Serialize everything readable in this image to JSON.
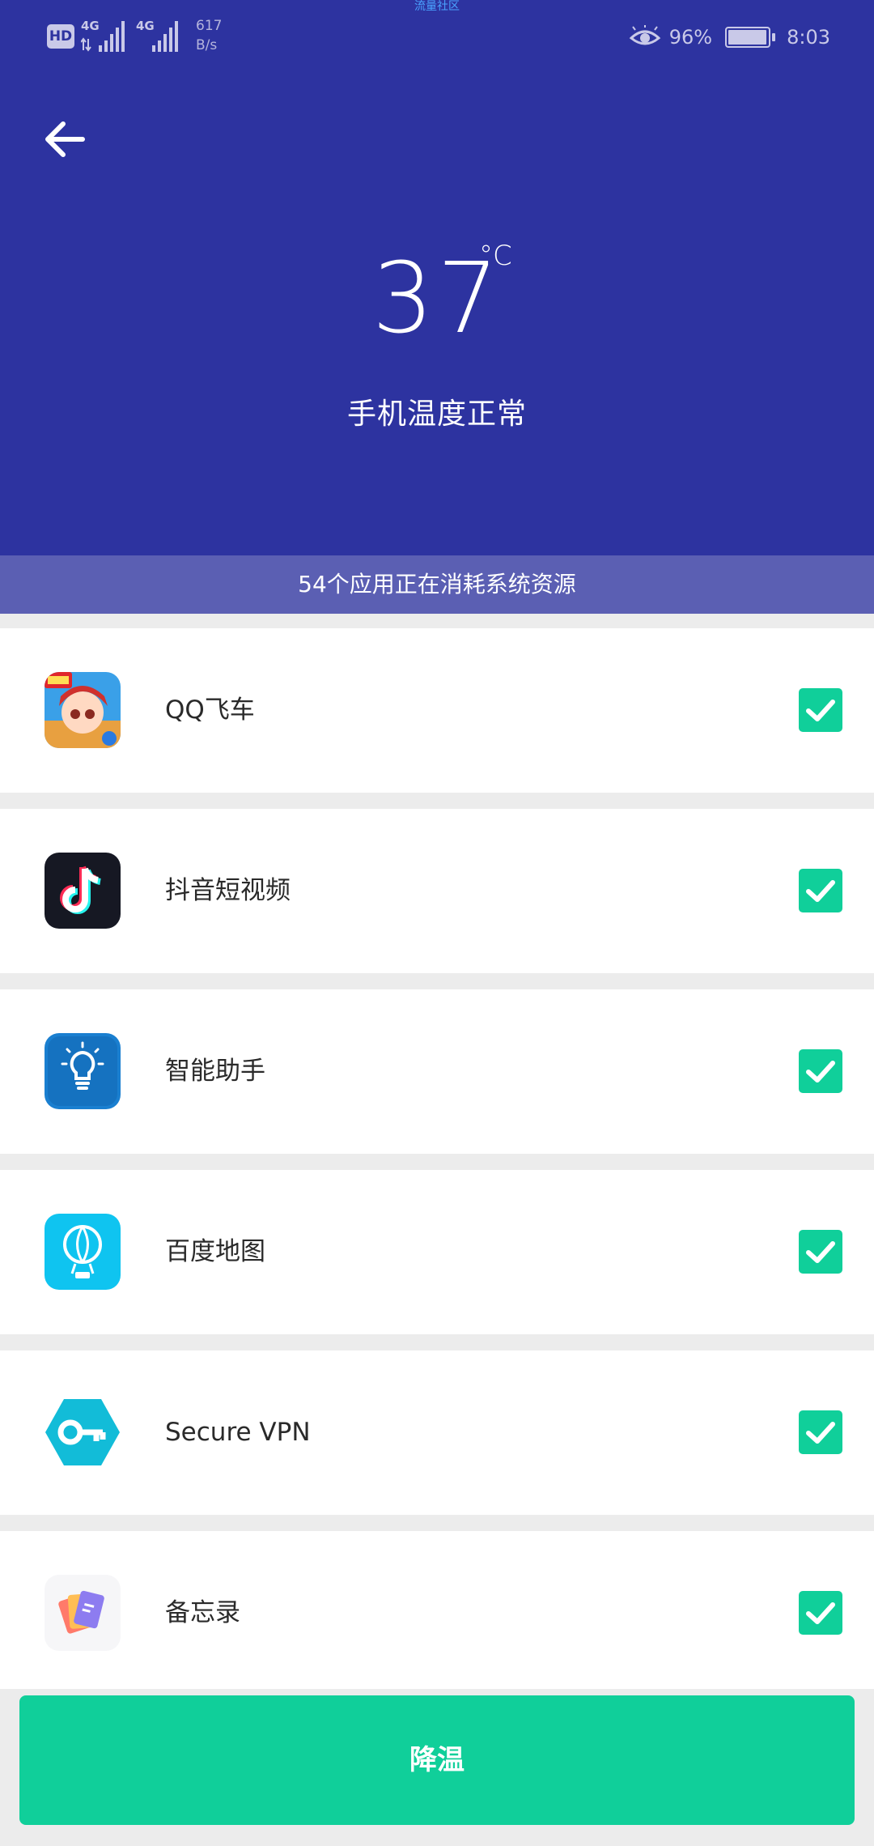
{
  "status_bar": {
    "watermark": "流量社区",
    "hd": "HD",
    "sim1": "4G",
    "sim2": "4G",
    "speed_value": "617",
    "speed_unit": "B/s",
    "battery_percent": "96%",
    "time": "8:03"
  },
  "header": {
    "temperature": "37",
    "unit": "°C",
    "status": "手机温度正常"
  },
  "app_count_text": "54个应用正在消耗系统资源",
  "apps": [
    {
      "name": "QQ飞车",
      "icon": "qq-speed-icon",
      "checked": true
    },
    {
      "name": "抖音短视频",
      "icon": "douyin-icon",
      "checked": true
    },
    {
      "name": "智能助手",
      "icon": "smart-assistant-icon",
      "checked": true
    },
    {
      "name": "百度地图",
      "icon": "baidu-map-icon",
      "checked": true
    },
    {
      "name": "Secure VPN",
      "icon": "secure-vpn-icon",
      "checked": true
    },
    {
      "name": "备忘录",
      "icon": "memo-icon",
      "checked": true
    }
  ],
  "cooldown_button": "降温",
  "colors": {
    "header_bg": "#2d33a0",
    "count_bar_bg": "#5b5fb3",
    "accent_green": "#10cf9a",
    "page_bg": "#ececec"
  }
}
